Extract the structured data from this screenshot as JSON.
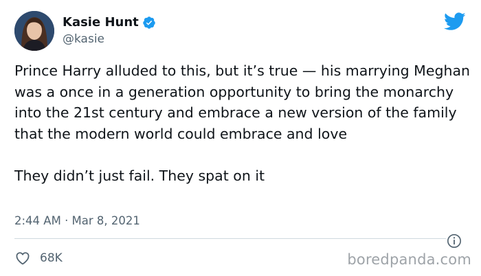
{
  "author": {
    "display_name": "Kasie Hunt",
    "handle": "@kasie"
  },
  "tweet": {
    "paragraph_1": "Prince Harry alluded to this, but it’s true — his marrying Meghan was a once in a generation opportunity to bring the monarchy into the 21st century and embrace a new version of the family that the modern world could embrace and love",
    "paragraph_2": "They didn’t just fail. They spat on it",
    "timestamp": "2:44 AM · Mar 8, 2021"
  },
  "actions": {
    "like_count": "68K"
  },
  "watermark": "boredpanda.com",
  "colors": {
    "brand": "#1d9bf0",
    "text": "#0f1419",
    "muted": "#536471"
  },
  "icons": [
    "verified-badge-icon",
    "twitter-bird-icon",
    "info-icon",
    "heart-icon"
  ]
}
